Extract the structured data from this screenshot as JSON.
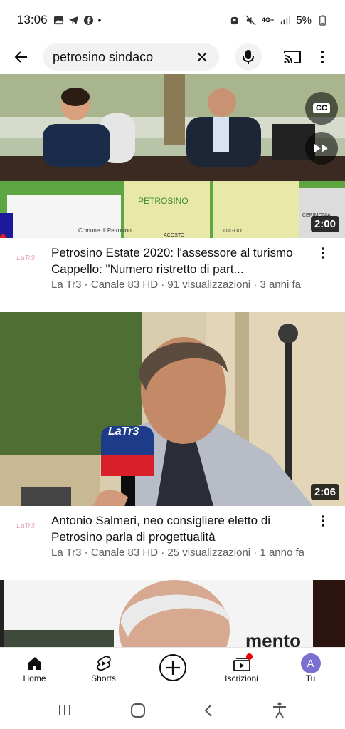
{
  "status": {
    "time": "13:06",
    "battery": "5%",
    "network": "4G+"
  },
  "search": {
    "query": "petrosino sindaco"
  },
  "videos": [
    {
      "title": "Petrosino Estate 2020: l'assessore al turismo Cappello: \"Numero ristretto di part...",
      "channel_line": "La Tr3 - Canale 83 HD · 91 visualizzazioni · 3 anni fa",
      "duration": "2:00",
      "avatar_label": "LaTr3"
    },
    {
      "title": "Antonio Salmeri, neo consigliere eletto di Petrosino parla di progettualità",
      "channel_line": "La Tr3 - Canale 83 HD · 25 visualizzazioni · 1 anno fa",
      "duration": "2:06",
      "avatar_label": "LaTr3"
    },
    {
      "banner_text": "mento"
    }
  ],
  "thumb_text": {
    "mic_logo": "LaTr3",
    "banner_brand": "PETROSINO",
    "comune": "Comune di Petrosino",
    "month_1": "ACOSTO",
    "month_2": "LUGLIO",
    "cerimonia": "CERIMONIA",
    "cc": "CC"
  },
  "bottom_nav": [
    {
      "label": "Home",
      "icon": "home-icon"
    },
    {
      "label": "Shorts",
      "icon": "shorts-icon"
    },
    {
      "label": "",
      "icon": "create-icon"
    },
    {
      "label": "Iscrizioni",
      "icon": "subscriptions-icon"
    },
    {
      "label": "Tu",
      "icon": "account-icon",
      "avatar_letter": "A"
    }
  ]
}
